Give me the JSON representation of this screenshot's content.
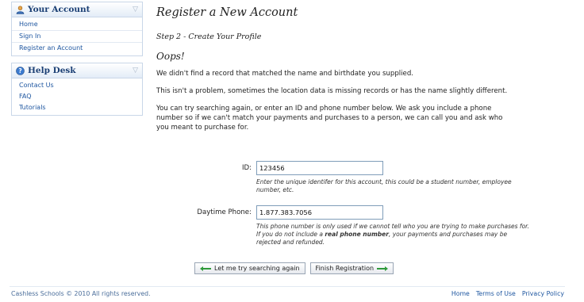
{
  "sidebar": {
    "account": {
      "title": "Your Account",
      "links": [
        "Home",
        "Sign In",
        "Register an Account"
      ]
    },
    "help": {
      "title": "Help Desk",
      "links": [
        "Contact Us",
        "FAQ",
        "Tutorials"
      ]
    }
  },
  "main": {
    "title": "Register a New Account",
    "step": "Step 2 - Create Your Profile",
    "oops": "Oops!",
    "p1": "We didn't find a record that matched the name and birthdate you supplied.",
    "p2": "This isn't a problem, sometimes the location data is missing records or has the name slightly different.",
    "p3_line1": "You can try searching again, or enter an ID and phone number below. We ask you include a phone",
    "p3_line2": "number so if we can't match your payments and purchases to a person, we can call you and ask who",
    "p3_line3": "you meant to purchase for."
  },
  "form": {
    "id_label": "ID:",
    "id_value": "123456",
    "id_help_line1": "Enter the unique identifer for this account, this could be a student number, employee",
    "id_help_line2": "number, etc.",
    "phone_label": "Daytime Phone:",
    "phone_value": "1.877.383.7056",
    "phone_help_line1": "This phone number is only used if we cannot tell who you are trying to make purchases for.",
    "phone_help_line2_pre": "If you do not include a ",
    "phone_help_line2_bold": "real phone number",
    "phone_help_line2_post": ", your payments and purchases may be",
    "phone_help_line3": "rejected and refunded."
  },
  "buttons": {
    "search_again": "Let me try searching again",
    "finish": "Finish Registration"
  },
  "footer": {
    "copyright": "Cashless Schools © 2010 All rights reserved.",
    "links": [
      "Home",
      "Terms of Use",
      "Privacy Policy"
    ]
  },
  "colors": {
    "link": "#1e56a0",
    "panel_border": "#c9d7e8",
    "arrow_green": "#2f9a3a"
  }
}
